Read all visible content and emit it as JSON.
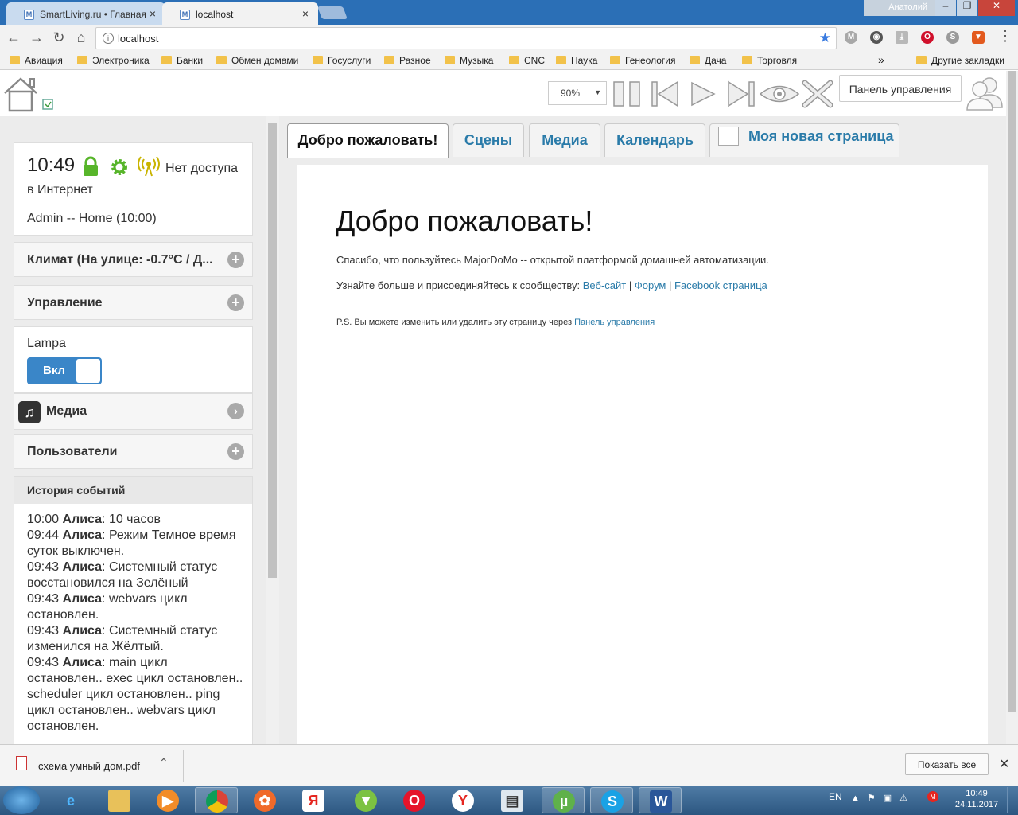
{
  "browser": {
    "tabs": [
      {
        "title": "SmartLiving.ru • Главная"
      },
      {
        "title": "localhost"
      }
    ],
    "window_user": "Анатолий",
    "url": "localhost",
    "bookmarks": [
      "Авиация",
      "Электроника",
      "Банки",
      "Обмен домами",
      "Госуслуги",
      "Разное",
      "Музыка",
      "CNC",
      "Наука",
      "Генеология",
      "Дача",
      "Торговля"
    ],
    "bookmarks_more": "»",
    "other_bookmarks": "Другие закладки"
  },
  "app": {
    "zoom": "90%",
    "zoom_options": [
      "90%"
    ],
    "control_panel_button": "Панель управления",
    "status": {
      "time": "10:49",
      "internet": "Нет доступа в Интернет",
      "user": "Admin -- Home (10:00)"
    },
    "sections": {
      "climate": "Климат (На улице: -0.7°C / Д...",
      "control": "Управление",
      "media": "Медиа",
      "users": "Пользователи"
    },
    "lamp": {
      "label": "Lampa",
      "state_label": "Вкл",
      "on": true
    },
    "history": {
      "title": "История событий",
      "events": [
        {
          "time": "10:00",
          "who": "Алиса",
          "text": ": 10 часов"
        },
        {
          "time": "09:44",
          "who": "Алиса",
          "text": ": Режим Темное время суток выключен."
        },
        {
          "time": "09:43",
          "who": "Алиса",
          "text": ": Системный статус восстановился на Зелёный"
        },
        {
          "time": "09:43",
          "who": "Алиса",
          "text": ": webvars цикл остановлен."
        },
        {
          "time": "09:43",
          "who": "Алиса",
          "text": ": Системный статус изменился на Жёлтый."
        },
        {
          "time": "09:43",
          "who": "Алиса",
          "text": ": main цикл остановлен.. exec цикл остановлен.. scheduler цикл остановлен.. ping цикл остановлен.. webvars цикл остановлен."
        }
      ]
    },
    "tabs": [
      "Добро пожаловать!",
      "Сцены",
      "Медиа",
      "Календарь",
      "Моя новая страница"
    ],
    "welcome": {
      "heading": "Добро пожаловать!",
      "line1": "Спасибо, что пользуйтесь MajorDoMo -- открытой платформой домашней автоматизации.",
      "line2_prefix": "Узнайте больше и присоединяйтесь к сообществу:",
      "link_site": "Веб-сайт",
      "link_forum": "Форум",
      "link_facebook": "Facebook страница",
      "separator": "|",
      "ps_prefix": "P.S. Вы можете изменить или удалить эту страницу через",
      "ps_link": "Панель управления"
    }
  },
  "downloads": {
    "file": "схема умный дом.pdf",
    "show_all": "Показать все"
  },
  "taskbar": {
    "lang": "EN",
    "time": "10:49",
    "date": "24.11.2017"
  },
  "colors": {
    "accent": "#2a7ba9",
    "toggle_on": "#3a86c8",
    "green_icon": "#57b52a",
    "taskbar": "#2c5680"
  }
}
